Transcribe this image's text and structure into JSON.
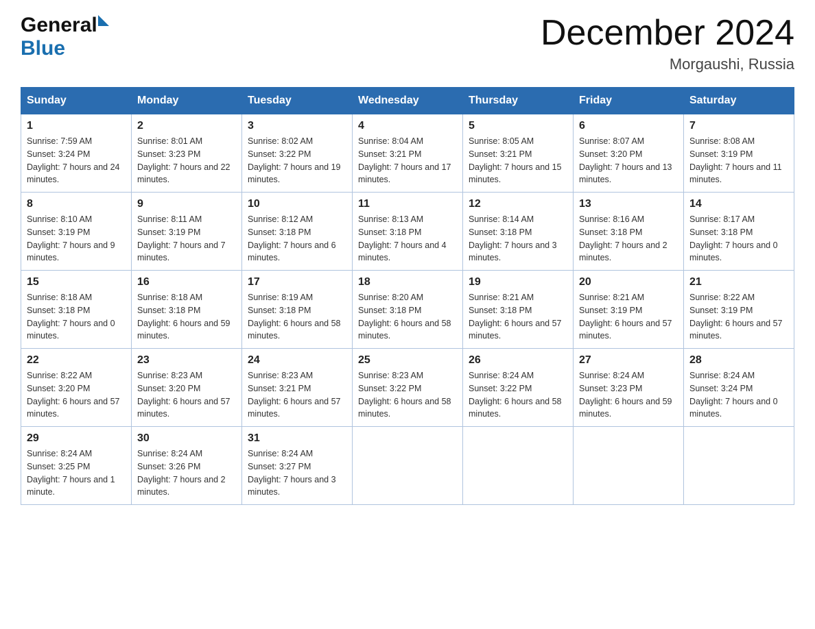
{
  "header": {
    "logo_general": "General",
    "logo_blue": "Blue",
    "month_title": "December 2024",
    "location": "Morgaushi, Russia"
  },
  "columns": [
    "Sunday",
    "Monday",
    "Tuesday",
    "Wednesday",
    "Thursday",
    "Friday",
    "Saturday"
  ],
  "weeks": [
    [
      {
        "day": "1",
        "sunrise": "Sunrise: 7:59 AM",
        "sunset": "Sunset: 3:24 PM",
        "daylight": "Daylight: 7 hours and 24 minutes."
      },
      {
        "day": "2",
        "sunrise": "Sunrise: 8:01 AM",
        "sunset": "Sunset: 3:23 PM",
        "daylight": "Daylight: 7 hours and 22 minutes."
      },
      {
        "day": "3",
        "sunrise": "Sunrise: 8:02 AM",
        "sunset": "Sunset: 3:22 PM",
        "daylight": "Daylight: 7 hours and 19 minutes."
      },
      {
        "day": "4",
        "sunrise": "Sunrise: 8:04 AM",
        "sunset": "Sunset: 3:21 PM",
        "daylight": "Daylight: 7 hours and 17 minutes."
      },
      {
        "day": "5",
        "sunrise": "Sunrise: 8:05 AM",
        "sunset": "Sunset: 3:21 PM",
        "daylight": "Daylight: 7 hours and 15 minutes."
      },
      {
        "day": "6",
        "sunrise": "Sunrise: 8:07 AM",
        "sunset": "Sunset: 3:20 PM",
        "daylight": "Daylight: 7 hours and 13 minutes."
      },
      {
        "day": "7",
        "sunrise": "Sunrise: 8:08 AM",
        "sunset": "Sunset: 3:19 PM",
        "daylight": "Daylight: 7 hours and 11 minutes."
      }
    ],
    [
      {
        "day": "8",
        "sunrise": "Sunrise: 8:10 AM",
        "sunset": "Sunset: 3:19 PM",
        "daylight": "Daylight: 7 hours and 9 minutes."
      },
      {
        "day": "9",
        "sunrise": "Sunrise: 8:11 AM",
        "sunset": "Sunset: 3:19 PM",
        "daylight": "Daylight: 7 hours and 7 minutes."
      },
      {
        "day": "10",
        "sunrise": "Sunrise: 8:12 AM",
        "sunset": "Sunset: 3:18 PM",
        "daylight": "Daylight: 7 hours and 6 minutes."
      },
      {
        "day": "11",
        "sunrise": "Sunrise: 8:13 AM",
        "sunset": "Sunset: 3:18 PM",
        "daylight": "Daylight: 7 hours and 4 minutes."
      },
      {
        "day": "12",
        "sunrise": "Sunrise: 8:14 AM",
        "sunset": "Sunset: 3:18 PM",
        "daylight": "Daylight: 7 hours and 3 minutes."
      },
      {
        "day": "13",
        "sunrise": "Sunrise: 8:16 AM",
        "sunset": "Sunset: 3:18 PM",
        "daylight": "Daylight: 7 hours and 2 minutes."
      },
      {
        "day": "14",
        "sunrise": "Sunrise: 8:17 AM",
        "sunset": "Sunset: 3:18 PM",
        "daylight": "Daylight: 7 hours and 0 minutes."
      }
    ],
    [
      {
        "day": "15",
        "sunrise": "Sunrise: 8:18 AM",
        "sunset": "Sunset: 3:18 PM",
        "daylight": "Daylight: 7 hours and 0 minutes."
      },
      {
        "day": "16",
        "sunrise": "Sunrise: 8:18 AM",
        "sunset": "Sunset: 3:18 PM",
        "daylight": "Daylight: 6 hours and 59 minutes."
      },
      {
        "day": "17",
        "sunrise": "Sunrise: 8:19 AM",
        "sunset": "Sunset: 3:18 PM",
        "daylight": "Daylight: 6 hours and 58 minutes."
      },
      {
        "day": "18",
        "sunrise": "Sunrise: 8:20 AM",
        "sunset": "Sunset: 3:18 PM",
        "daylight": "Daylight: 6 hours and 58 minutes."
      },
      {
        "day": "19",
        "sunrise": "Sunrise: 8:21 AM",
        "sunset": "Sunset: 3:18 PM",
        "daylight": "Daylight: 6 hours and 57 minutes."
      },
      {
        "day": "20",
        "sunrise": "Sunrise: 8:21 AM",
        "sunset": "Sunset: 3:19 PM",
        "daylight": "Daylight: 6 hours and 57 minutes."
      },
      {
        "day": "21",
        "sunrise": "Sunrise: 8:22 AM",
        "sunset": "Sunset: 3:19 PM",
        "daylight": "Daylight: 6 hours and 57 minutes."
      }
    ],
    [
      {
        "day": "22",
        "sunrise": "Sunrise: 8:22 AM",
        "sunset": "Sunset: 3:20 PM",
        "daylight": "Daylight: 6 hours and 57 minutes."
      },
      {
        "day": "23",
        "sunrise": "Sunrise: 8:23 AM",
        "sunset": "Sunset: 3:20 PM",
        "daylight": "Daylight: 6 hours and 57 minutes."
      },
      {
        "day": "24",
        "sunrise": "Sunrise: 8:23 AM",
        "sunset": "Sunset: 3:21 PM",
        "daylight": "Daylight: 6 hours and 57 minutes."
      },
      {
        "day": "25",
        "sunrise": "Sunrise: 8:23 AM",
        "sunset": "Sunset: 3:22 PM",
        "daylight": "Daylight: 6 hours and 58 minutes."
      },
      {
        "day": "26",
        "sunrise": "Sunrise: 8:24 AM",
        "sunset": "Sunset: 3:22 PM",
        "daylight": "Daylight: 6 hours and 58 minutes."
      },
      {
        "day": "27",
        "sunrise": "Sunrise: 8:24 AM",
        "sunset": "Sunset: 3:23 PM",
        "daylight": "Daylight: 6 hours and 59 minutes."
      },
      {
        "day": "28",
        "sunrise": "Sunrise: 8:24 AM",
        "sunset": "Sunset: 3:24 PM",
        "daylight": "Daylight: 7 hours and 0 minutes."
      }
    ],
    [
      {
        "day": "29",
        "sunrise": "Sunrise: 8:24 AM",
        "sunset": "Sunset: 3:25 PM",
        "daylight": "Daylight: 7 hours and 1 minute."
      },
      {
        "day": "30",
        "sunrise": "Sunrise: 8:24 AM",
        "sunset": "Sunset: 3:26 PM",
        "daylight": "Daylight: 7 hours and 2 minutes."
      },
      {
        "day": "31",
        "sunrise": "Sunrise: 8:24 AM",
        "sunset": "Sunset: 3:27 PM",
        "daylight": "Daylight: 7 hours and 3 minutes."
      },
      null,
      null,
      null,
      null
    ]
  ]
}
